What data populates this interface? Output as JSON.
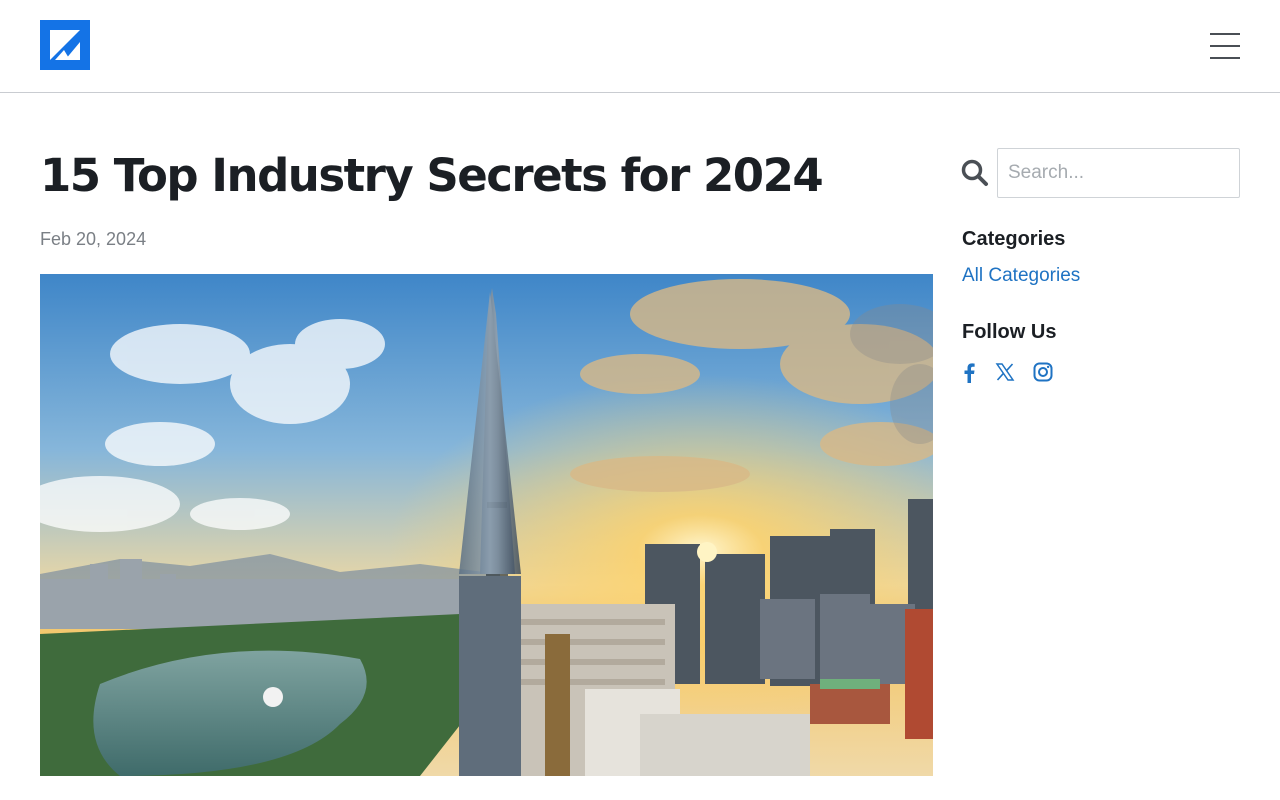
{
  "header": {
    "logo_icon": "brand-k-logo",
    "menu_icon": "hamburger-menu-icon"
  },
  "article": {
    "title": "15 Top Industry Secrets for 2024",
    "date": "Feb 20, 2024",
    "hero_image": "city-skyline-sunset-photo"
  },
  "sidebar": {
    "search": {
      "placeholder": "Search...",
      "value": "",
      "icon": "search-icon"
    },
    "categories_heading": "Categories",
    "categories": [
      "All Categories"
    ],
    "follow_heading": "Follow Us",
    "social_icons": [
      "facebook-icon",
      "x-icon",
      "instagram-icon"
    ]
  },
  "colors": {
    "brand": "#1473e6",
    "link": "#1f73c3",
    "heading": "#1b1f24",
    "muted": "#7a7f85"
  }
}
